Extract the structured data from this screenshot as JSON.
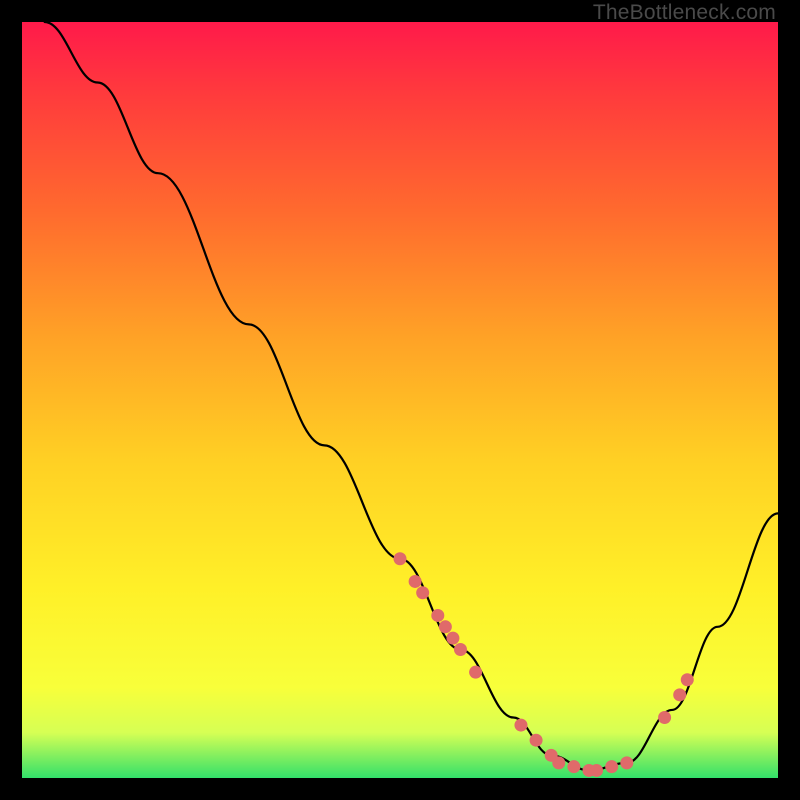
{
  "watermark": "TheBottleneck.com",
  "chart_data": {
    "type": "line",
    "title": "",
    "xlabel": "",
    "ylabel": "",
    "xlim": [
      0,
      100
    ],
    "ylim": [
      0,
      100
    ],
    "curve": [
      {
        "x": 3,
        "y": 100
      },
      {
        "x": 10,
        "y": 92
      },
      {
        "x": 18,
        "y": 80
      },
      {
        "x": 30,
        "y": 60
      },
      {
        "x": 40,
        "y": 44
      },
      {
        "x": 50,
        "y": 29
      },
      {
        "x": 58,
        "y": 17
      },
      {
        "x": 65,
        "y": 8
      },
      {
        "x": 70,
        "y": 3
      },
      {
        "x": 75,
        "y": 1
      },
      {
        "x": 80,
        "y": 2
      },
      {
        "x": 86,
        "y": 9
      },
      {
        "x": 92,
        "y": 20
      },
      {
        "x": 100,
        "y": 35
      }
    ],
    "points": [
      {
        "x": 50,
        "y": 29
      },
      {
        "x": 52,
        "y": 26
      },
      {
        "x": 53,
        "y": 24.5
      },
      {
        "x": 55,
        "y": 21.5
      },
      {
        "x": 56,
        "y": 20
      },
      {
        "x": 57,
        "y": 18.5
      },
      {
        "x": 58,
        "y": 17
      },
      {
        "x": 60,
        "y": 14
      },
      {
        "x": 66,
        "y": 7
      },
      {
        "x": 68,
        "y": 5
      },
      {
        "x": 70,
        "y": 3
      },
      {
        "x": 71,
        "y": 2
      },
      {
        "x": 73,
        "y": 1.5
      },
      {
        "x": 75,
        "y": 1
      },
      {
        "x": 76,
        "y": 1
      },
      {
        "x": 78,
        "y": 1.5
      },
      {
        "x": 80,
        "y": 2
      },
      {
        "x": 85,
        "y": 8
      },
      {
        "x": 87,
        "y": 11
      },
      {
        "x": 88,
        "y": 13
      }
    ],
    "point_color": "#e06a6a",
    "curve_color": "#000000"
  }
}
